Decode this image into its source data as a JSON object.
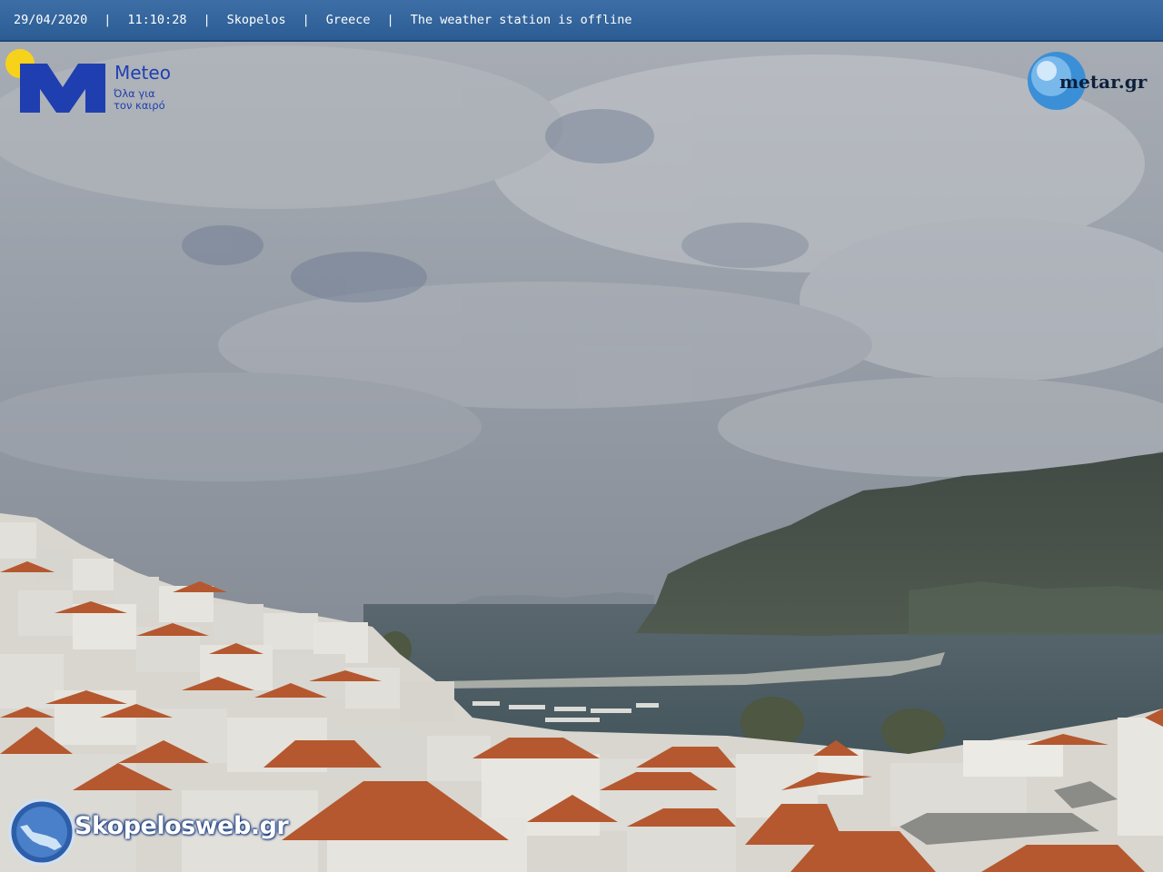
{
  "overlay": {
    "date": "29/04/2020",
    "time": "11:10:28",
    "location": "Skopelos",
    "country": "Greece",
    "status": "The weather station is offline",
    "separator": "|"
  },
  "logos": {
    "meteo": {
      "name": "Meteo",
      "tagline_1": "Όλα για",
      "tagline_2": "τον καιρό"
    },
    "metar": {
      "name": "metar.gr"
    },
    "skopelosweb": {
      "name": "Skopelosweb.gr"
    }
  },
  "colors": {
    "bar": "#2f5f96",
    "meteo_blue": "#1f3fb0",
    "sun_yellow": "#f7d21a",
    "roof": "#b5582f",
    "sea": "#4f5f66",
    "sky": "#9aa0a8"
  }
}
